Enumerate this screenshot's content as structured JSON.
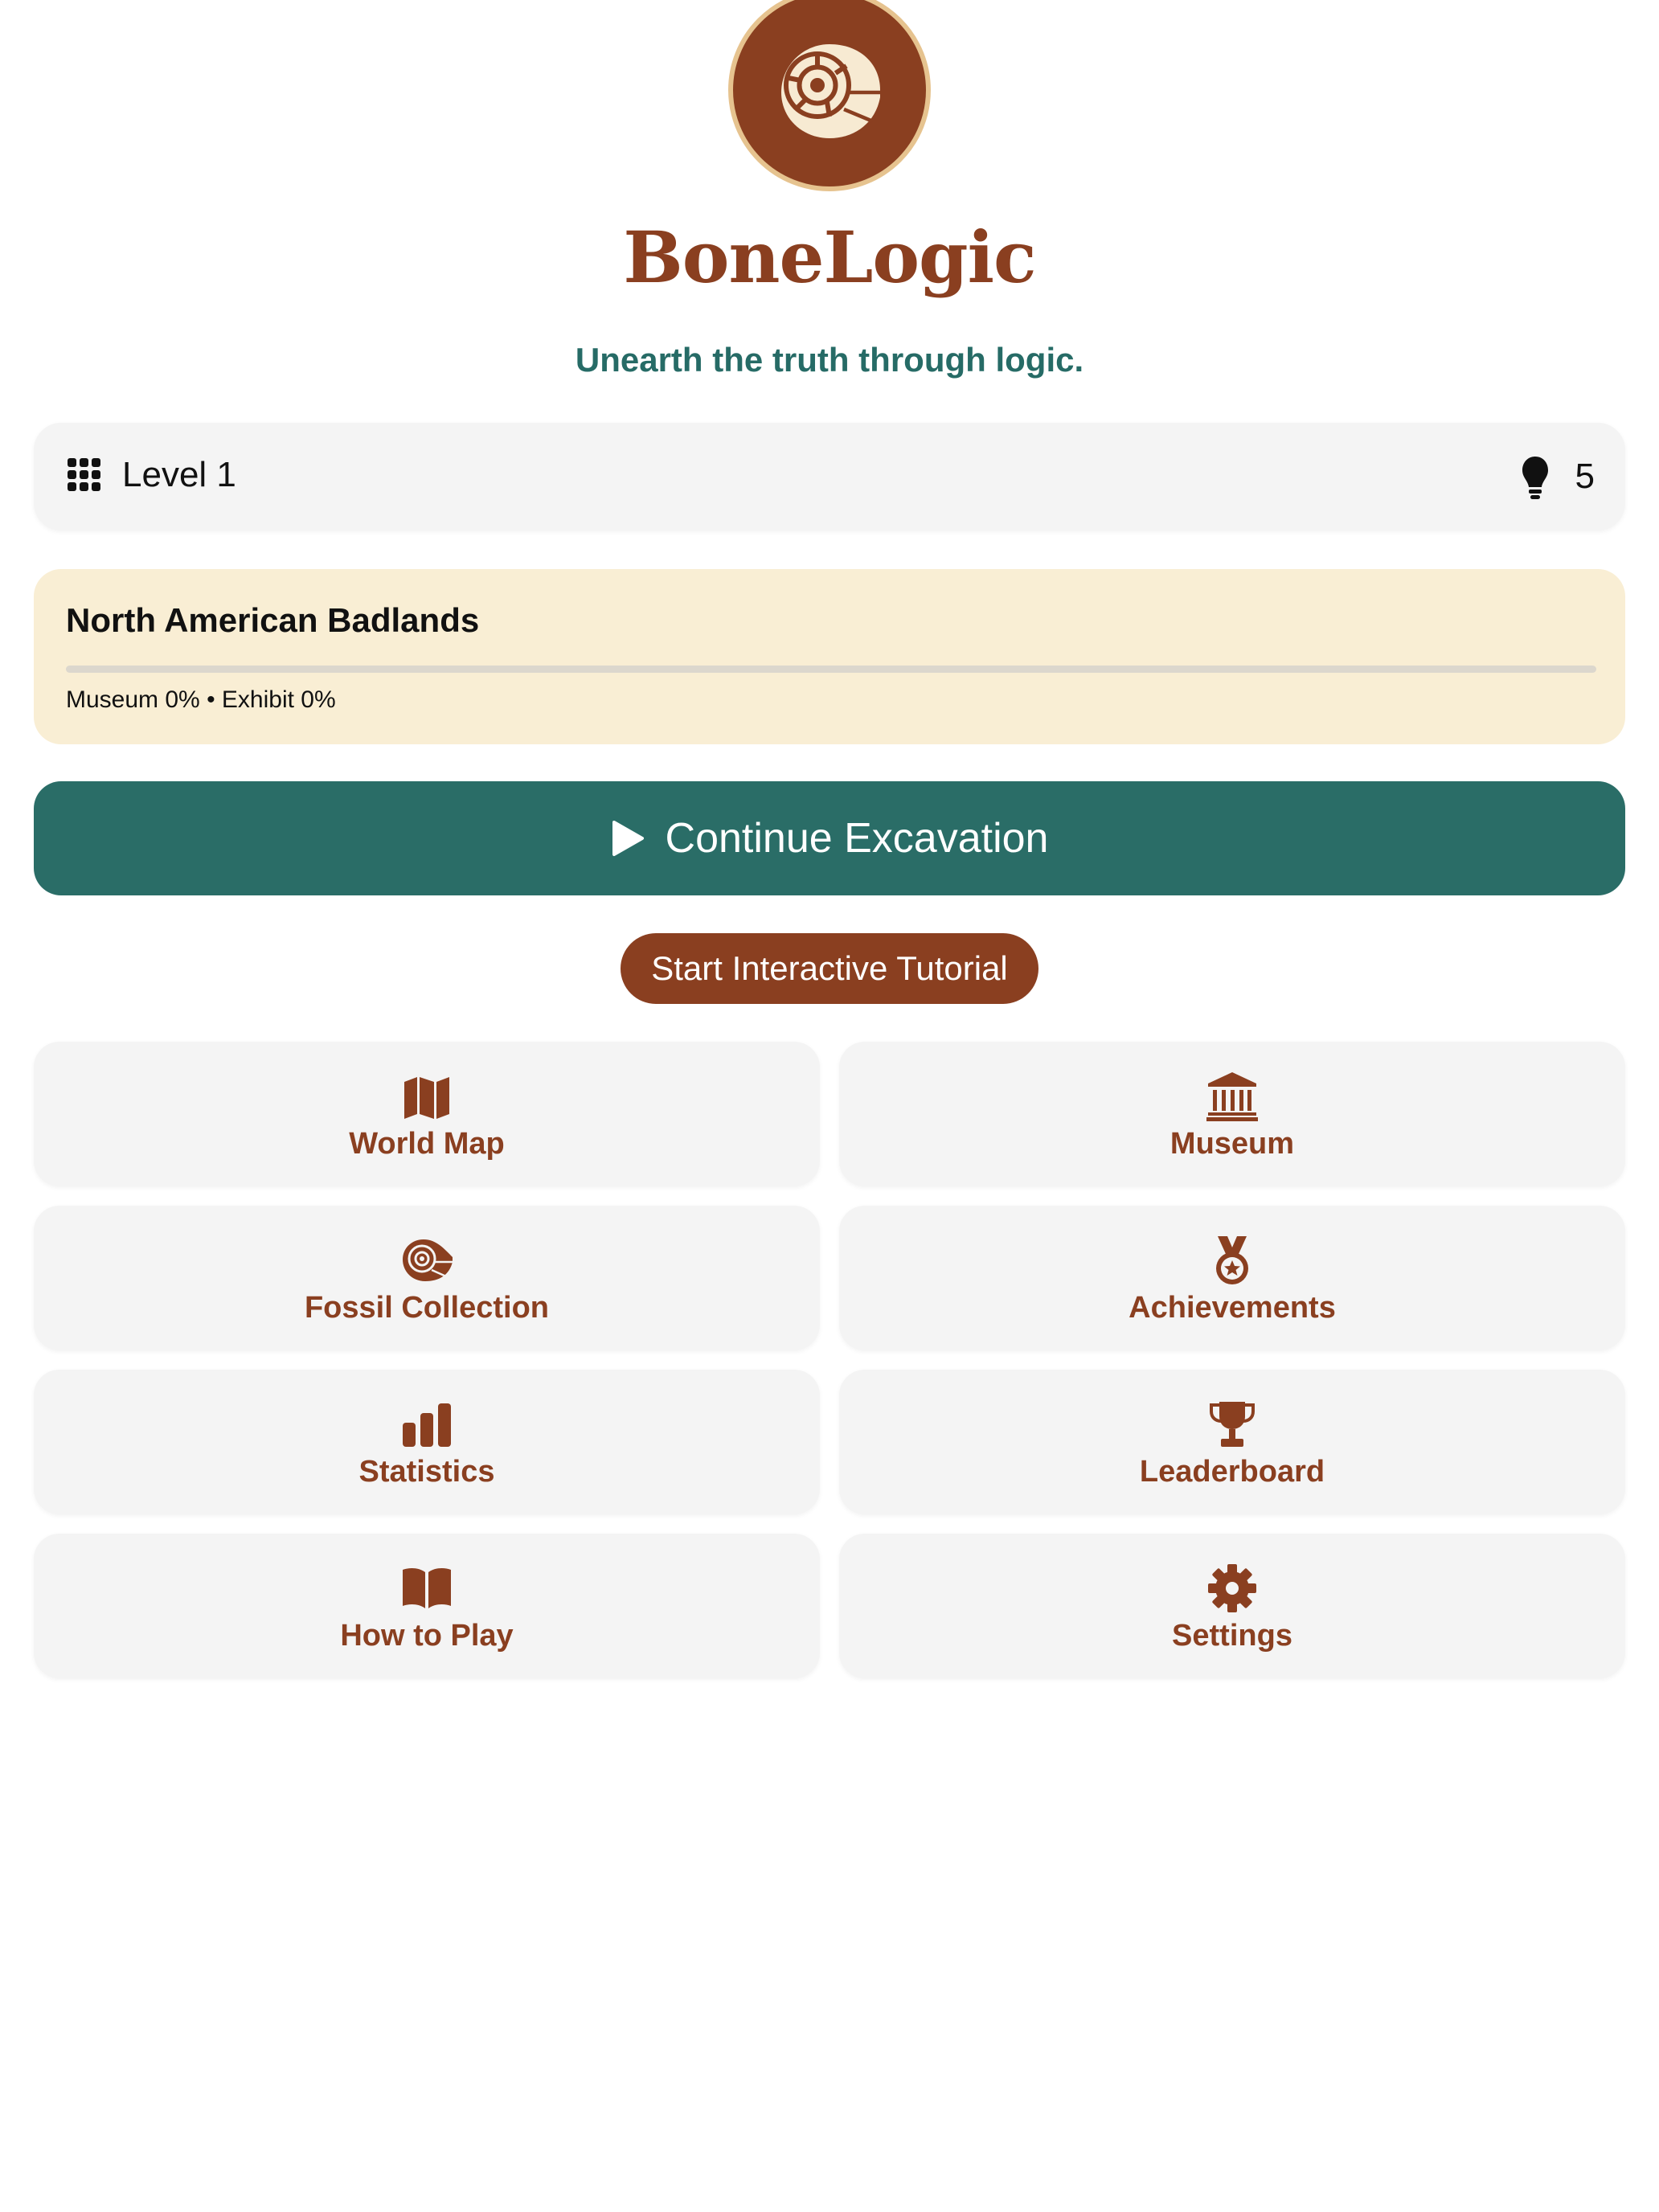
{
  "app": {
    "title": "BoneLogic",
    "tagline": "Unearth the truth through logic."
  },
  "status": {
    "level_label": "Level 1",
    "hints_count": "5"
  },
  "region": {
    "name": "North American Badlands",
    "stats": "Museum 0% • Exhibit 0%",
    "progress": 0
  },
  "actions": {
    "continue_label": "Continue Excavation",
    "tutorial_label": "Start Interactive Tutorial"
  },
  "menu": [
    {
      "label": "World Map",
      "icon": "map-icon"
    },
    {
      "label": "Museum",
      "icon": "museum-icon"
    },
    {
      "label": "Fossil Collection",
      "icon": "ammonite-icon"
    },
    {
      "label": "Achievements",
      "icon": "medal-icon"
    },
    {
      "label": "Statistics",
      "icon": "bar-chart-icon"
    },
    {
      "label": "Leaderboard",
      "icon": "trophy-icon"
    },
    {
      "label": "How to Play",
      "icon": "book-icon"
    },
    {
      "label": "Settings",
      "icon": "gear-icon"
    }
  ],
  "colors": {
    "brand": "#8a3f20",
    "accent": "#2a6d67",
    "region_bg": "#f9eed4",
    "logo_ring": "#e6c38f"
  }
}
